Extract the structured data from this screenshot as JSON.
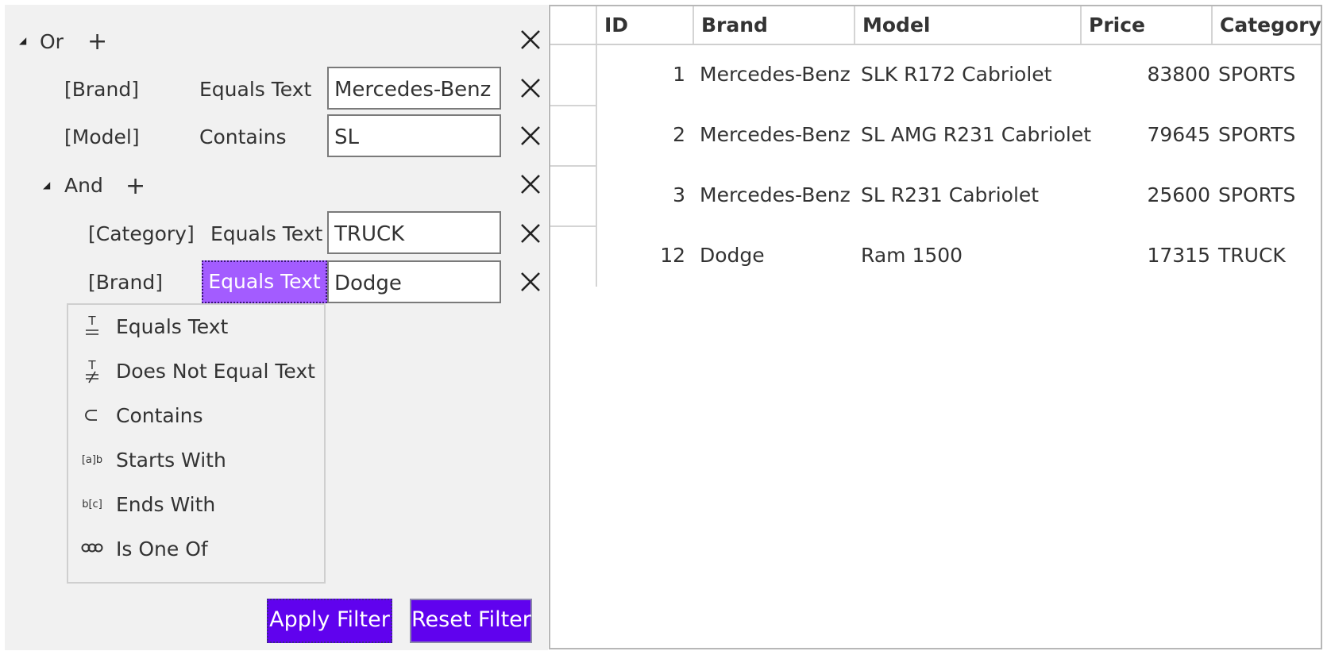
{
  "filter": {
    "root": {
      "logic": "Or",
      "conditions": [
        {
          "field": "[Brand]",
          "operator": "Equals Text",
          "value": "Mercedes-Benz"
        },
        {
          "field": "[Model]",
          "operator": "Contains",
          "value": "SL"
        }
      ],
      "group": {
        "logic": "And",
        "conditions": [
          {
            "field": "[Category]",
            "operator": "Equals Text",
            "value": "TRUCK"
          },
          {
            "field": "[Brand]",
            "operator": "Equals Text",
            "value": "Dodge"
          }
        ]
      }
    },
    "operator_menu": [
      {
        "label": "Equals Text",
        "icon": "equals-text-icon"
      },
      {
        "label": "Does Not Equal Text",
        "icon": "not-equal-text-icon"
      },
      {
        "label": "Contains",
        "icon": "contains-icon"
      },
      {
        "label": "Starts With",
        "icon": "starts-with-icon"
      },
      {
        "label": "Ends With",
        "icon": "ends-with-icon"
      },
      {
        "label": "Is One Of",
        "icon": "is-one-of-icon"
      }
    ],
    "apply_label": "Apply Filter",
    "reset_label": "Reset Filter",
    "accent_color": "#6002ee",
    "selected_color": "#a35cff"
  },
  "grid": {
    "columns": [
      "ID",
      "Brand",
      "Model",
      "Price",
      "Category"
    ],
    "rows": [
      {
        "id": "1",
        "brand": "Mercedes-Benz",
        "model": "SLK R172 Cabriolet",
        "price": "83800",
        "category": "SPORTS"
      },
      {
        "id": "2",
        "brand": "Mercedes-Benz",
        "model": "SL AMG R231 Cabriolet",
        "price": "79645",
        "category": "SPORTS"
      },
      {
        "id": "3",
        "brand": "Mercedes-Benz",
        "model": "SL R231 Cabriolet",
        "price": "25600",
        "category": "SPORTS"
      },
      {
        "id": "12",
        "brand": "Dodge",
        "model": "Ram 1500",
        "price": "17315",
        "category": "TRUCK"
      }
    ]
  }
}
